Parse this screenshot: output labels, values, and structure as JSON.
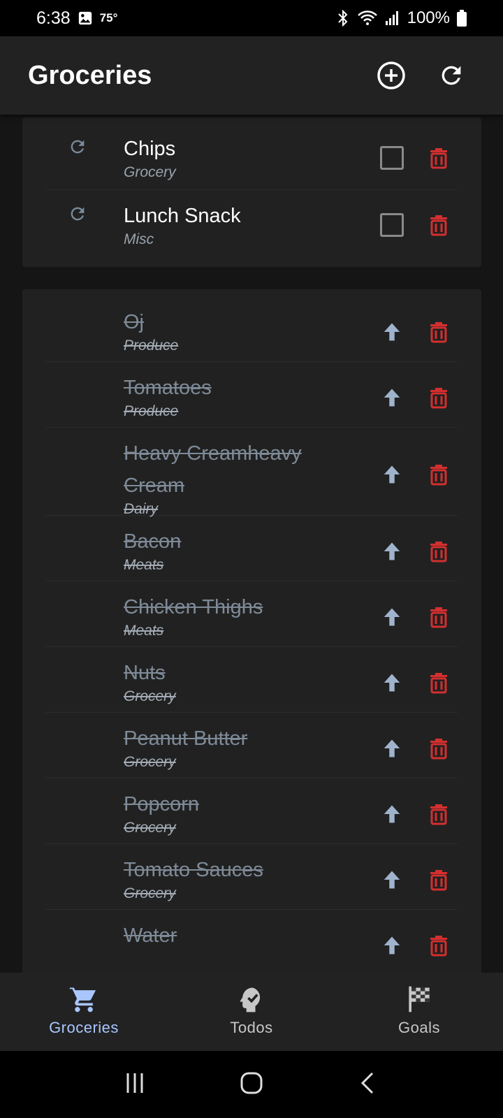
{
  "status_bar": {
    "time": "6:38",
    "temperature": "75°",
    "battery": "100%",
    "icons": [
      "gallery-icon",
      "bluetooth-icon",
      "wifi-icon",
      "signal-icon",
      "battery-icon"
    ]
  },
  "app_bar": {
    "title": "Groceries",
    "actions": [
      "add-circle-icon",
      "refresh-icon"
    ]
  },
  "active_items": [
    {
      "name": "Chips",
      "category": "Grocery"
    },
    {
      "name": "Lunch Snack",
      "category": "Misc"
    }
  ],
  "completed_items": [
    {
      "name": "Oj",
      "category": "Produce"
    },
    {
      "name": "Tomatoes",
      "category": "Produce"
    },
    {
      "name": "Heavy Creamheavy Cream",
      "category": "Dairy"
    },
    {
      "name": "Bacon",
      "category": "Meats"
    },
    {
      "name": "Chicken Thighs",
      "category": "Meats"
    },
    {
      "name": "Nuts",
      "category": "Grocery"
    },
    {
      "name": "Peanut Butter",
      "category": "Grocery"
    },
    {
      "name": "Popcorn",
      "category": "Grocery"
    },
    {
      "name": "Tomato Sauces",
      "category": "Grocery"
    },
    {
      "name": "Water",
      "category": ""
    }
  ],
  "bottom_nav": [
    {
      "label": "Groceries",
      "icon": "cart-icon",
      "active": true
    },
    {
      "label": "Todos",
      "icon": "head-check-icon",
      "active": false
    },
    {
      "label": "Goals",
      "icon": "checkered-flag-icon",
      "active": false
    }
  ],
  "colors": {
    "accent": "#a9c6ff",
    "delete": "#d32f2f",
    "arrow": "#9fb3cc",
    "card": "#212121",
    "appbar": "#222222"
  }
}
